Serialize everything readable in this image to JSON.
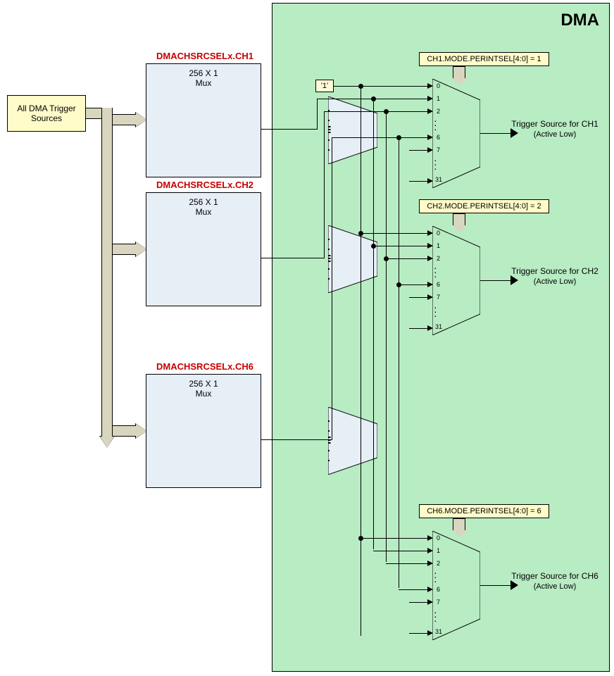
{
  "dma_title": "DMA",
  "source_label": "All DMA Trigger Sources",
  "one_label": "'1'",
  "xbars": [
    {
      "title": "DMACHSRCSELx.CH1",
      "size": "256 X 1",
      "type": "Mux"
    },
    {
      "title": "DMACHSRCSELx.CH2",
      "size": "256 X 1",
      "type": "Mux"
    },
    {
      "title": "DMACHSRCSELx.CH6",
      "size": "256 X 1",
      "type": "Mux"
    }
  ],
  "cfg": [
    "CH1.MODE.PERINTSEL[4:0] = 1",
    "CH2.MODE.PERINTSEL[4:0] = 2",
    "CH6.MODE.PERINTSEL[4:0] = 6"
  ],
  "outputs": [
    {
      "l1": "Trigger Source for CH1",
      "l2": "(Active Low)"
    },
    {
      "l1": "Trigger Source for CH2",
      "l2": "(Active Low)"
    },
    {
      "l1": "Trigger Source for CH6",
      "l2": "(Active Low)"
    }
  ],
  "mux_inputs": [
    "0",
    "1",
    "2",
    "6",
    "7",
    "31"
  ]
}
